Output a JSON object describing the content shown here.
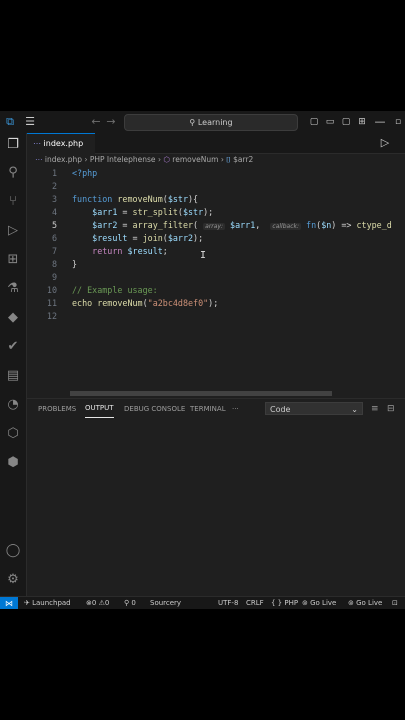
{
  "titlebar": {
    "search_placeholder": "Learning",
    "vscode_icon": "vscode-logo-icon",
    "menu_icon": "hamburger-icon",
    "back_icon": "arrow-left-icon",
    "forward_icon": "arrow-right-icon"
  },
  "tab": {
    "label": "index.php",
    "icon": "php-icon"
  },
  "breadcrumbs": {
    "file": "index.php",
    "lsp": "PHP Intelephense",
    "function": "removeNum",
    "variable": "$arr2"
  },
  "editor": {
    "line_numbers": [
      "1",
      "2",
      "3",
      "4",
      "5",
      "6",
      "7",
      "8",
      "9",
      "10",
      "11",
      "12"
    ],
    "current_line": 5,
    "hints": {
      "array": "array:",
      "callback": "callback:"
    }
  },
  "panel": {
    "tabs": [
      "PROBLEMS",
      "OUTPUT",
      "DEBUG CONSOLE",
      "TERMINAL"
    ],
    "active_tab": "OUTPUT",
    "more": "···",
    "output_channel": "Code"
  },
  "statusbar": {
    "launchpad": "Launchpad",
    "errors": "0",
    "warnings": "0",
    "ports": "0",
    "sourcery": "Sourcery",
    "encoding": "UTF-8",
    "eol": "CRLF",
    "language": "PHP",
    "go_live_1": "Go Live",
    "go_live_2": "Go Live"
  },
  "colors": {
    "accent": "#0078d4",
    "background": "#1f1f1f",
    "sidebar": "#181818"
  }
}
